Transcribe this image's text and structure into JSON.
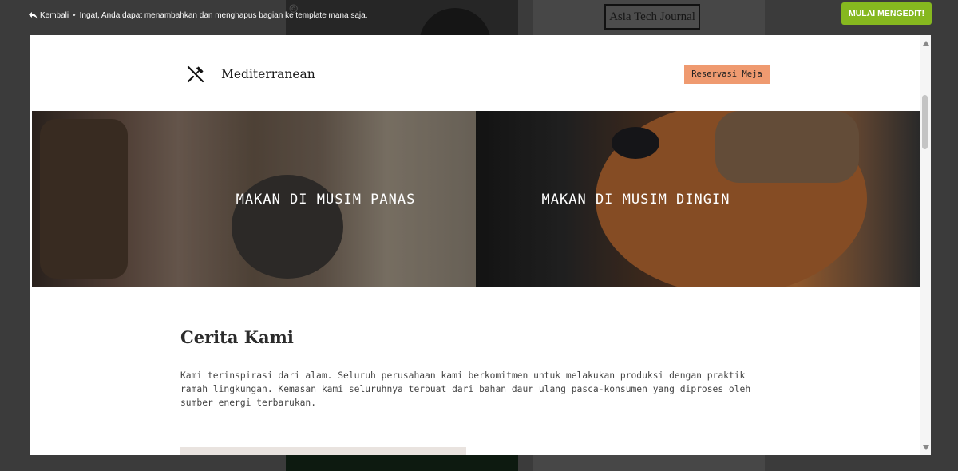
{
  "topbar": {
    "back_label": "Kembali",
    "separator": "•",
    "notice": "Ingat, Anda dapat menambahkan dan menghapus bagian ke template mana saja.",
    "start_button": "MULAI MENGEDIT!"
  },
  "background": {
    "logo_text": "Asia Tech Journal"
  },
  "site": {
    "name": "Mediterranean",
    "reserve_button": "Reservasi Meja"
  },
  "hero": {
    "left_label": "MAKAN DI MUSIM PANAS",
    "right_label": "MAKAN DI MUSIM DINGIN"
  },
  "story": {
    "title": "Cerita Kami",
    "body": "Kami terinspirasi dari alam. Seluruh perusahaan kami berkomitmen untuk melakukan produksi dengan praktik ramah lingkungan. Kemasan kami seluruhnya terbuat dari bahan daur ulang pasca-konsumen yang diproses oleh sumber energi terbarukan."
  },
  "colors": {
    "start_button_bg": "#86b81f",
    "reserve_button_bg": "#ef9a70"
  }
}
